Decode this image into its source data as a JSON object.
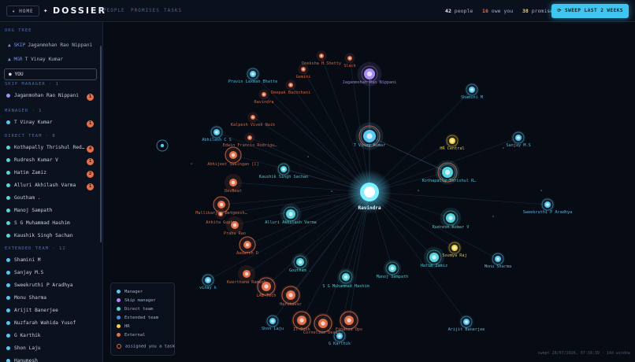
{
  "header": {
    "home_label": "◂ HOME",
    "brand": "DOSSIER",
    "brand_icon": "diamond-icon",
    "nav": [
      "PEOPLE",
      "PROMISES",
      "TASKS"
    ],
    "stats": {
      "people": "42",
      "people_label": "people",
      "owe": "16",
      "owe_label": "owe you",
      "promises": "38",
      "promises_label": "promises"
    },
    "sweep_label": "⟳ SWEEP LAST 2 WEEKS"
  },
  "sidebar": {
    "org_tree_title": "ORG TREE",
    "tree": [
      {
        "prefix": "▲ SKIP",
        "name": "Jaganmohan Rao Nippani"
      },
      {
        "prefix": "▲ MGR",
        "name": "T Vinay Kumar"
      }
    ],
    "you_label": "● YOU",
    "sections": [
      {
        "title": "SKIP MANAGER · 1",
        "items": [
          {
            "name": "Jaganmohan Rao Nippani",
            "color": "#a98cf5",
            "badge": "1"
          }
        ]
      },
      {
        "title": "MANAGER · 1",
        "items": [
          {
            "name": "T Vinay Kumar",
            "color": "#5cc8f0",
            "badge": "1"
          }
        ]
      },
      {
        "title": "DIRECT TEAM · 8",
        "items": [
          {
            "name": "Kothapally Thrishul Red…",
            "color": "#56d6e0",
            "badge": "4"
          },
          {
            "name": "Rudresh Kumar V",
            "color": "#56d6e0",
            "badge": "1"
          },
          {
            "name": "Hatim Zamiz",
            "color": "#56d6e0",
            "badge": "2"
          },
          {
            "name": "Alluri Akhilash Varma",
            "color": "#56d6e0",
            "badge": "1"
          },
          {
            "name": "Goutham .",
            "color": "#56d6e0",
            "badge": ""
          },
          {
            "name": "Manoj Sampath",
            "color": "#56d6e0",
            "badge": ""
          },
          {
            "name": "S G Muhammad Hashim",
            "color": "#56d6e0",
            "badge": ""
          },
          {
            "name": "Kaushik Singh Sachan",
            "color": "#56d6e0",
            "badge": ""
          }
        ]
      },
      {
        "title": "EXTENDED TEAM · 12",
        "items": [
          {
            "name": "Shamini M",
            "color": "#5cc8f0",
            "badge": ""
          },
          {
            "name": "Sanjay M.S",
            "color": "#5cc8f0",
            "badge": ""
          },
          {
            "name": "Sweekruthi P Aradhya",
            "color": "#5cc8f0",
            "badge": ""
          },
          {
            "name": "Monu Sharma",
            "color": "#5cc8f0",
            "badge": ""
          },
          {
            "name": "Arijit Banerjee",
            "color": "#5cc8f0",
            "badge": ""
          },
          {
            "name": "Nuzfarah Wahida Yusof",
            "color": "#5cc8f0",
            "badge": ""
          },
          {
            "name": "G Karthik",
            "color": "#5cc8f0",
            "badge": ""
          },
          {
            "name": "Shon Laju",
            "color": "#5cc8f0",
            "badge": ""
          },
          {
            "name": "Hanumesh",
            "color": "#5cc8f0",
            "badge": ""
          }
        ]
      }
    ]
  },
  "legend": {
    "items": [
      {
        "label": "Manager",
        "color": "#5cc8f0"
      },
      {
        "label": "Skip manager",
        "color": "#a98cf5"
      },
      {
        "label": "Direct team",
        "color": "#56d6e0"
      },
      {
        "label": "Extended team",
        "color": "#4a8fd8"
      },
      {
        "label": "HR",
        "color": "#f2d34a"
      },
      {
        "label": "External",
        "color": "#e2704a"
      }
    ],
    "assigned_label": "assigned you a task"
  },
  "graph": {
    "center": {
      "name": "Ravindra"
    },
    "nodes": [
      {
        "name": "Jaganmohan Rao Nippani",
        "type": "skip",
        "task": false
      },
      {
        "name": "T Vinay Kumar",
        "type": "manager",
        "task": true
      },
      {
        "name": "Kothapally Thrishul R…",
        "type": "direct",
        "task": true
      },
      {
        "name": "Rudresh Kumar V",
        "type": "direct",
        "task": false
      },
      {
        "name": "Hatim Zamiz",
        "type": "direct",
        "task": false
      },
      {
        "name": "Alluri Akhilash Varma",
        "type": "direct",
        "task": false
      },
      {
        "name": "Goutham .",
        "type": "direct",
        "task": false
      },
      {
        "name": "Manoj Sampath",
        "type": "direct",
        "task": false
      },
      {
        "name": "S G Muhammad Hashim",
        "type": "direct",
        "task": false
      },
      {
        "name": "Kaushik Singh Sachan",
        "type": "direct",
        "task": false
      },
      {
        "name": "Shamini M",
        "type": "extended",
        "task": false
      },
      {
        "name": "Sanjay M.S",
        "type": "extended",
        "task": false
      },
      {
        "name": "Sweekruthi P Aradhya",
        "type": "extended",
        "task": false
      },
      {
        "name": "Monu Sharma",
        "type": "extended",
        "task": false
      },
      {
        "name": "Arijit Banerjee",
        "type": "extended",
        "task": false
      },
      {
        "name": "Shon Laju",
        "type": "extended",
        "task": false
      },
      {
        "name": "G Karthik",
        "type": "extended",
        "task": false
      },
      {
        "name": "vinay k",
        "type": "extended",
        "task": false
      },
      {
        "name": "Abhilash C S",
        "type": "extended",
        "task": false
      },
      {
        "name": "Pravin Laxman Bhatte",
        "type": "extended",
        "task": false
      },
      {
        "name": "HR Central",
        "type": "hr",
        "task": false
      },
      {
        "name": "Soumya Raj",
        "type": "hr",
        "task": false
      },
      {
        "name": "Deeksha H Shetty",
        "type": "external",
        "task": false
      },
      {
        "name": "Slack",
        "type": "external",
        "task": false
      },
      {
        "name": "Gemini",
        "type": "external",
        "task": false
      },
      {
        "name": "Deepak Bachchani",
        "type": "external",
        "task": false
      },
      {
        "name": "Ravindra",
        "type": "external",
        "task": false
      },
      {
        "name": "Kalpesh Vivek Naik",
        "type": "external",
        "task": false
      },
      {
        "name": "Edwin Francis Rodrigu…",
        "type": "external",
        "task": false
      },
      {
        "name": "Abhijeet Swaingan [C]",
        "type": "external",
        "task": true
      },
      {
        "name": "DevBeat",
        "type": "external",
        "task": false
      },
      {
        "name": "Mallikarjun Betgeesh…",
        "type": "external",
        "task": true
      },
      {
        "name": "Ankita Gupta",
        "type": "external",
        "task": false
      },
      {
        "name": "Prabu Rao",
        "type": "external",
        "task": false
      },
      {
        "name": "Aadarsh D",
        "type": "external",
        "task": true
      },
      {
        "name": "Keerthana Ramesh",
        "type": "external",
        "task": false
      },
      {
        "name": "LAB-Tech",
        "type": "external",
        "task": true
      },
      {
        "name": "Harshavar",
        "type": "external",
        "task": true
      },
      {
        "name": "IT-Desk",
        "type": "external",
        "task": true
      },
      {
        "name": "Cornelius Desai…",
        "type": "external",
        "task": true
      },
      {
        "name": "Finance Ops",
        "type": "external",
        "task": true
      }
    ]
  },
  "footer": {
    "text": "swept 28/07/2026, 07:38:39 · 14d window"
  }
}
